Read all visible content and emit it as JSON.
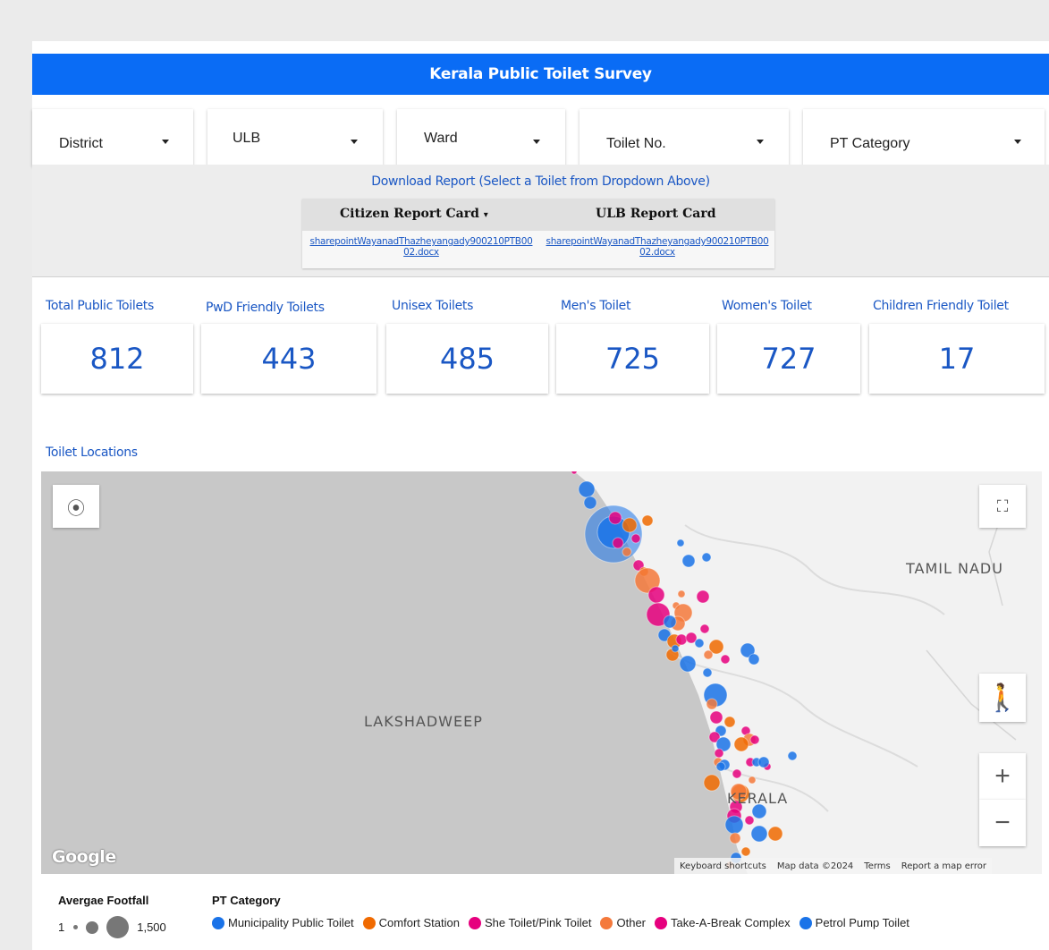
{
  "title": "Kerala Public Toilet Survey",
  "filters": [
    {
      "label": "District"
    },
    {
      "label": "ULB"
    },
    {
      "label": "Ward"
    },
    {
      "label": "Toilet No."
    },
    {
      "label": "PT Category"
    }
  ],
  "download": {
    "heading": "Download Report (Select a Toilet from Dropdown Above)",
    "col1_header": "Citizen Report Card",
    "col2_header": "ULB Report Card",
    "col1_link": "sharepointWayanadThazheyangady900210PTB0002.docx",
    "col2_link": "sharepointWayanadThazheyangady900210PTB0002.docx"
  },
  "scorecards": [
    {
      "label": "Total Public Toilets",
      "value": "812"
    },
    {
      "label": "PwD Friendly Toilets",
      "value": "443"
    },
    {
      "label": "Unisex Toilets",
      "value": "485"
    },
    {
      "label": "Men's Toilet",
      "value": "725"
    },
    {
      "label": "Women's Toilet",
      "value": "727"
    },
    {
      "label": "Children Friendly Toilet",
      "value": "17"
    }
  ],
  "map": {
    "section_title": "Toilet Locations",
    "region_labels": {
      "tamil_nadu": "TAMIL NADU",
      "lakshadweep": "LAKSHADWEEP",
      "kerala": "KERALA"
    },
    "google": "Google",
    "attribution": {
      "shortcuts": "Keyboard shortcuts",
      "data": "Map data ©2024",
      "terms": "Terms",
      "report": "Report a map error"
    }
  },
  "legend": {
    "footfall_title": "Avergae Footfall",
    "footfall_min": "1",
    "footfall_max": "1,500",
    "category_title": "PT Category",
    "categories": [
      {
        "name": "Municipality Public Toilet",
        "color": "#1a73e8"
      },
      {
        "name": "Comfort Station",
        "color": "#f06a00"
      },
      {
        "name": "She Toilet/Pink Toilet",
        "color": "#e6007e"
      },
      {
        "name": "Other",
        "color": "#f4793b"
      },
      {
        "name": "Take-A-Break Complex",
        "color": "#e6007e"
      },
      {
        "name": "Petrol Pump Toilet",
        "color": "#1a73e8"
      }
    ]
  },
  "colors": {
    "brand": "#0a6cf5",
    "link": "#1a57c4"
  }
}
